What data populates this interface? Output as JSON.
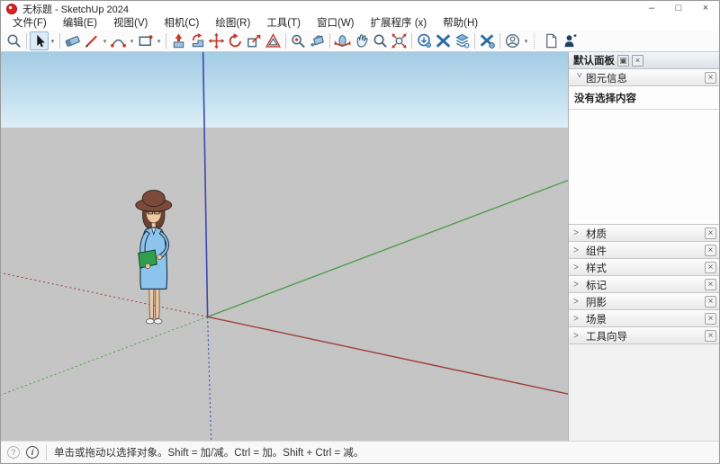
{
  "window": {
    "title": "无标题 - SketchUp 2024",
    "controls": {
      "minimize": "–",
      "maximize": "□",
      "close": "×"
    }
  },
  "menu": {
    "items": [
      "文件(F)",
      "编辑(E)",
      "视图(V)",
      "相机(C)",
      "绘图(R)",
      "工具(T)",
      "窗口(W)",
      "扩展程序 (x)",
      "帮助(H)"
    ]
  },
  "toolbar": {
    "tools": [
      "search",
      "select",
      "eraser",
      "line",
      "arc",
      "rectangle",
      "push-pull",
      "follow-me",
      "move",
      "rotate",
      "scale",
      "offset",
      "tape-measure",
      "paint-bucket",
      "orbit",
      "pan",
      "zoom",
      "zoom-extents",
      "3d-warehouse",
      "exchange",
      "share-layers",
      "extension-manager",
      "account",
      "new-file",
      "add-person"
    ],
    "selected_tool": "select"
  },
  "panel": {
    "title": "默认面板",
    "entity_info": {
      "label": "图元信息",
      "empty_message": "没有选择内容"
    },
    "sections": [
      "材质",
      "组件",
      "样式",
      "标记",
      "阴影",
      "场景",
      "工具向导"
    ],
    "chevron_collapsed": ">",
    "chevron_expanded": "∨",
    "close_glyph": "×",
    "pin_glyph": "▣"
  },
  "statusbar": {
    "geo_glyph": "?",
    "info_glyph": "i",
    "message": "单击或拖动以选择对象。Shift = 加/减。Ctrl = 加。Shift + Ctrl = 减。"
  },
  "scene": {
    "colors": {
      "sky_top": "#a3cce4",
      "sky_bottom": "#ddeff8",
      "ground": "#c5c5c5",
      "axis_red": "#a03c3c",
      "axis_green": "#4e9e4e",
      "axis_blue": "#3d46b5",
      "figure_dress": "#8cc4ee",
      "figure_skin": "#efc9a2",
      "figure_hair": "#6b4134",
      "figure_folder": "#2f9e4f"
    }
  }
}
